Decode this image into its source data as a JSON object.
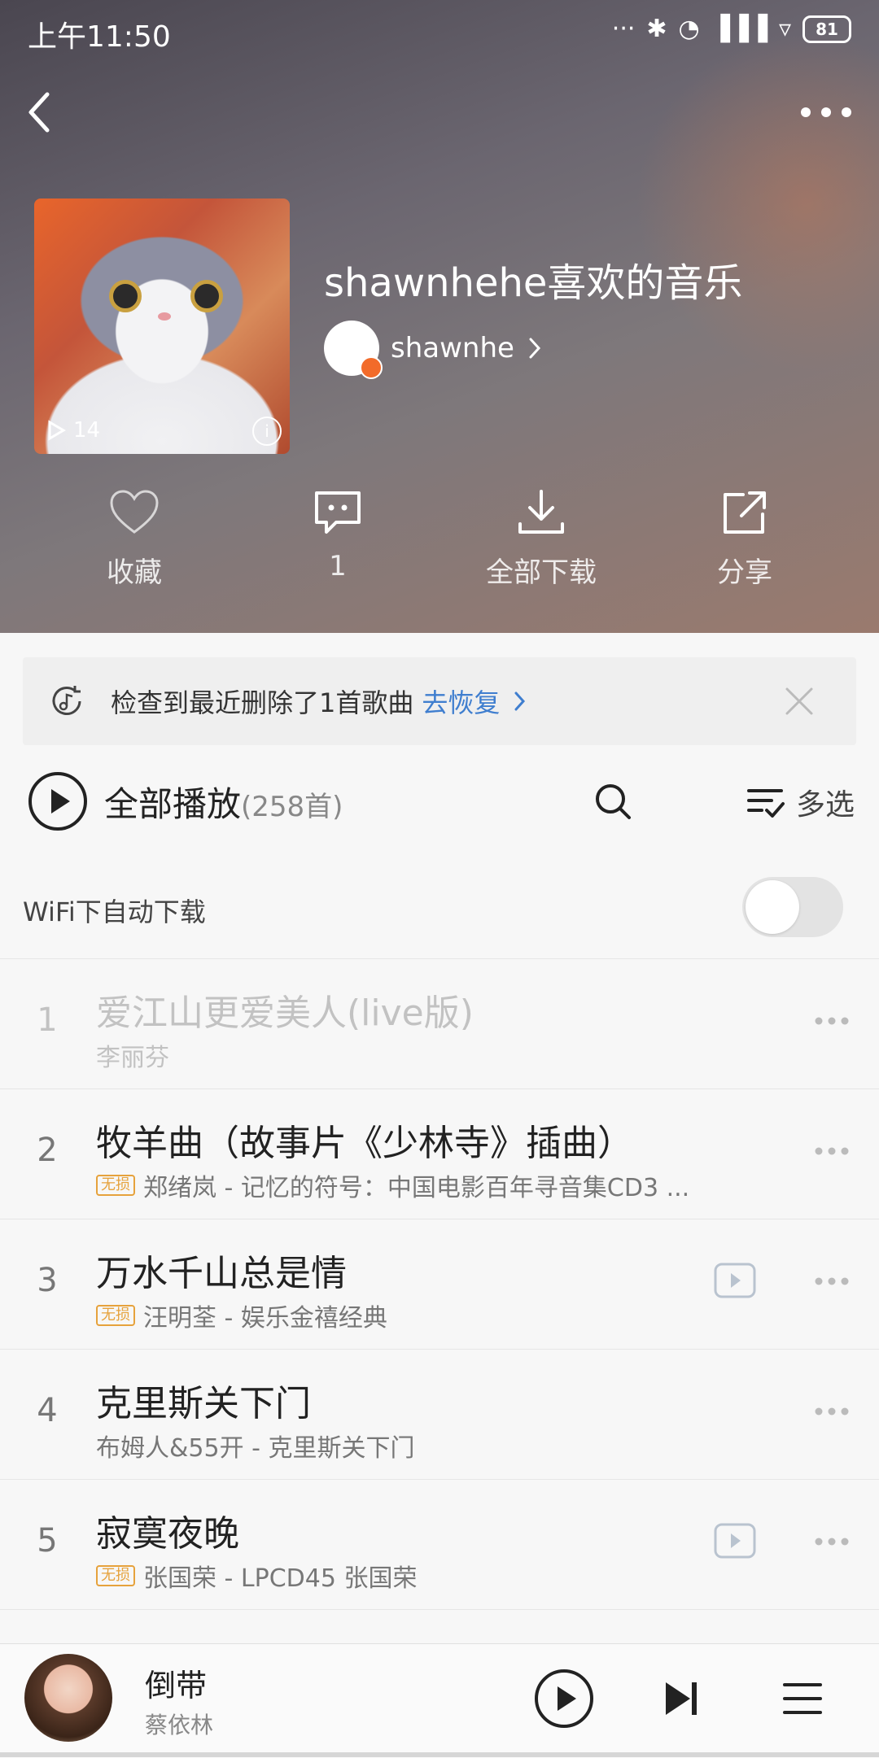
{
  "status_bar": {
    "time": "上午11:50",
    "dots": "···",
    "battery": "81"
  },
  "playlist": {
    "title": "shawnhehe喜欢的音乐",
    "owner": "shawnhe",
    "play_count": "14"
  },
  "actions": [
    {
      "label": "收藏",
      "icon": "heart-icon"
    },
    {
      "label": "1",
      "icon": "comment-icon"
    },
    {
      "label": "全部下载",
      "icon": "download-icon"
    },
    {
      "label": "分享",
      "icon": "share-icon"
    }
  ],
  "notice": {
    "text": "检查到最近删除了1首歌曲",
    "link": "去恢复"
  },
  "toolbar": {
    "play_all": "全部播放",
    "count": "(258首)",
    "multi_select": "多选"
  },
  "wifi_download": {
    "label": "WiFi下自动下载",
    "enabled": false
  },
  "songs": [
    {
      "index": "1",
      "title": "爱江山更爱美人(live版)",
      "subtitle": "李丽芬",
      "lossless": false,
      "mv": false,
      "dimmed": true
    },
    {
      "index": "2",
      "title": "牧羊曲（故事片《少林寺》插曲）",
      "subtitle": "郑绪岚 - 记忆的符号：中国电影百年寻音集CD3 ...",
      "lossless": true,
      "mv": false,
      "dimmed": false
    },
    {
      "index": "3",
      "title": "万水千山总是情",
      "subtitle": "汪明荃 - 娱乐金禧经典",
      "lossless": true,
      "mv": true,
      "dimmed": false
    },
    {
      "index": "4",
      "title": "克里斯关下门",
      "subtitle": "布姆人&55开 - 克里斯关下门",
      "lossless": false,
      "mv": false,
      "dimmed": false
    },
    {
      "index": "5",
      "title": "寂寞夜晚",
      "subtitle": "张国荣 - LPCD45 张国荣",
      "lossless": true,
      "mv": true,
      "dimmed": false
    }
  ],
  "lossless_badge": "无损",
  "mini_player": {
    "title": "倒带",
    "artist": "蔡依林"
  }
}
